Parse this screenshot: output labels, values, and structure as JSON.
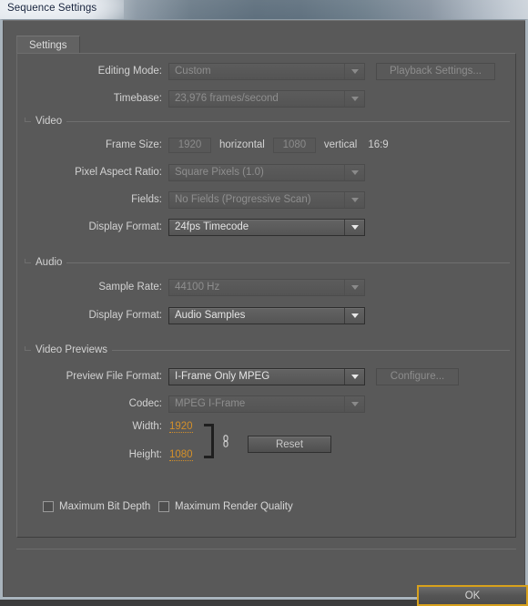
{
  "window": {
    "title": "Sequence Settings"
  },
  "tabs": [
    {
      "label": "Settings",
      "active": true
    }
  ],
  "colors": {
    "accent_scrub": "#d4902a",
    "focus_ring": "#d8a11c",
    "panel_bg": "#595959",
    "label_text": "#d2d2d2",
    "disabled_text": "#8b8b8b"
  },
  "top_fields": {
    "editing_mode": {
      "label": "Editing Mode:",
      "value": "Custom",
      "enabled": false
    },
    "playback_settings": {
      "label": "Playback Settings...",
      "enabled": false
    },
    "timebase": {
      "label": "Timebase:",
      "value": "23,976 frames/second",
      "enabled": false
    }
  },
  "video": {
    "group_title": "Video",
    "frame_size": {
      "label": "Frame Size:",
      "horizontal_value": "1920",
      "horizontal_label": "horizontal",
      "vertical_value": "1080",
      "vertical_label": "vertical",
      "aspect_ratio": "16:9",
      "enabled": false
    },
    "pixel_aspect_ratio": {
      "label": "Pixel Aspect Ratio:",
      "value": "Square Pixels (1.0)",
      "enabled": false
    },
    "fields": {
      "label": "Fields:",
      "value": "No Fields (Progressive Scan)",
      "enabled": false
    },
    "display_format": {
      "label": "Display Format:",
      "value": "24fps Timecode",
      "enabled": true
    }
  },
  "audio": {
    "group_title": "Audio",
    "sample_rate": {
      "label": "Sample Rate:",
      "value": "44100 Hz",
      "enabled": false
    },
    "display_format": {
      "label": "Display Format:",
      "value": "Audio Samples",
      "enabled": true
    }
  },
  "video_previews": {
    "group_title": "Video Previews",
    "preview_file_format": {
      "label": "Preview File Format:",
      "value": "I-Frame Only MPEG",
      "enabled": true
    },
    "configure": {
      "label": "Configure...",
      "enabled": false
    },
    "codec": {
      "label": "Codec:",
      "value": "MPEG I-Frame",
      "enabled": false
    },
    "width": {
      "label": "Width:",
      "value": "1920"
    },
    "height": {
      "label": "Height:",
      "value": "1080"
    },
    "link_icon": "chain-link-icon",
    "reset": {
      "label": "Reset",
      "enabled": true
    },
    "max_bit_depth": {
      "label": "Maximum Bit Depth",
      "checked": false
    },
    "max_render_quality": {
      "label": "Maximum Render Quality",
      "checked": false
    }
  },
  "footer": {
    "ok": {
      "label": "OK",
      "focused": true
    }
  }
}
